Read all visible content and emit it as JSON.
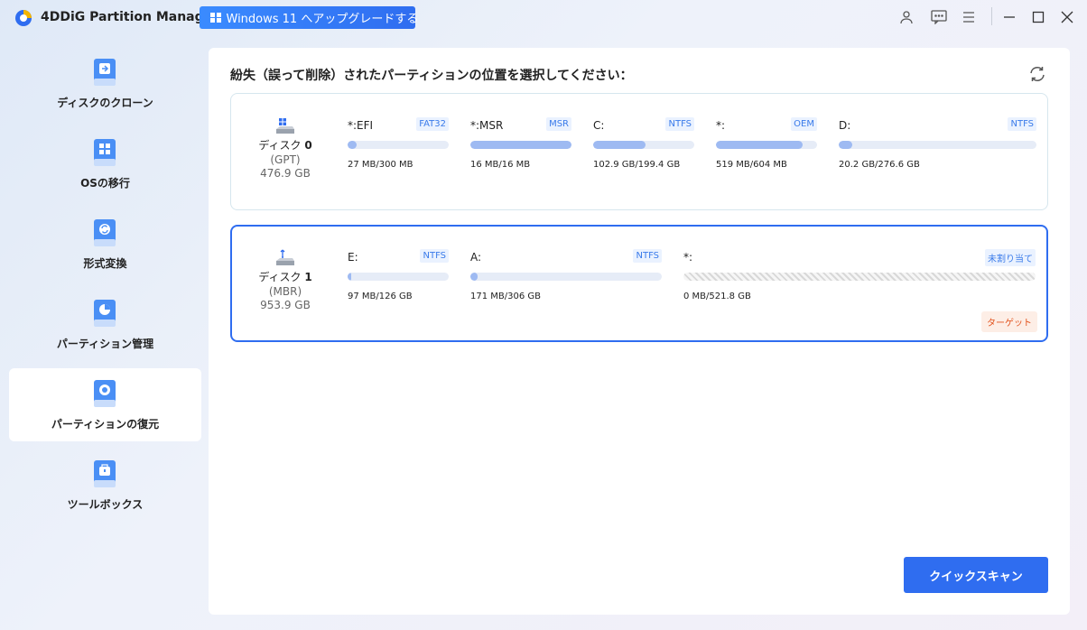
{
  "app": {
    "title": "4DDiG Partition Manager",
    "upgrade_label": "Windows 11 へアップグレードする"
  },
  "colors": {
    "accent": "#2f6df0",
    "bar_fill": "#9ebaf2",
    "target_badge": "#e2541f"
  },
  "sidebar": {
    "items": [
      {
        "label": "ディスクのクローン",
        "icon": "disk-clone-icon",
        "active": false
      },
      {
        "label": "OSの移行",
        "icon": "os-migration-icon",
        "active": false
      },
      {
        "label": "形式変換",
        "icon": "format-convert-icon",
        "active": false
      },
      {
        "label": "パーティション管理",
        "icon": "partition-manage-icon",
        "active": false
      },
      {
        "label": "パーティションの復元",
        "icon": "partition-recovery-icon",
        "active": true
      },
      {
        "label": "ツールボックス",
        "icon": "toolbox-icon",
        "active": false
      }
    ]
  },
  "main": {
    "heading": "紛失（誤って削除）されたパーティションの位置を選択してください：",
    "scan_label": "クイックスキャン",
    "disks": [
      {
        "name_prefix": "ディスク",
        "number": "0",
        "type": "(GPT)",
        "size": "476.9 GB",
        "partitions": [
          {
            "label": "*:EFI",
            "fs": "FAT32",
            "usage": "27 MB/300 MB",
            "fill": 0.09
          },
          {
            "label": "*:MSR",
            "fs": "MSR",
            "usage": "16 MB/16 MB",
            "fill": 1.0
          },
          {
            "label": "C:",
            "fs": "NTFS",
            "usage": "102.9 GB/199.4 GB",
            "fill": 0.52
          },
          {
            "label": "*:",
            "fs": "OEM",
            "usage": "519 MB/604 MB",
            "fill": 0.86
          },
          {
            "label": "D:",
            "fs": "NTFS",
            "usage": "20.2 GB/276.6 GB",
            "fill": 0.07
          }
        ]
      },
      {
        "name_prefix": "ディスク",
        "number": "1",
        "type": "(MBR)",
        "size": "953.9 GB",
        "target_label": "ターゲット",
        "partitions": [
          {
            "label": "E:",
            "fs": "NTFS",
            "usage": "97 MB/126 GB",
            "fill": 0.01
          },
          {
            "label": "A:",
            "fs": "NTFS",
            "usage": "171 MB/306 GB",
            "fill": 0.01
          },
          {
            "label": "*:",
            "fs": "未割り当て",
            "usage": "0 MB/521.8 GB",
            "fill": 0,
            "unallocated": true
          }
        ]
      }
    ]
  }
}
